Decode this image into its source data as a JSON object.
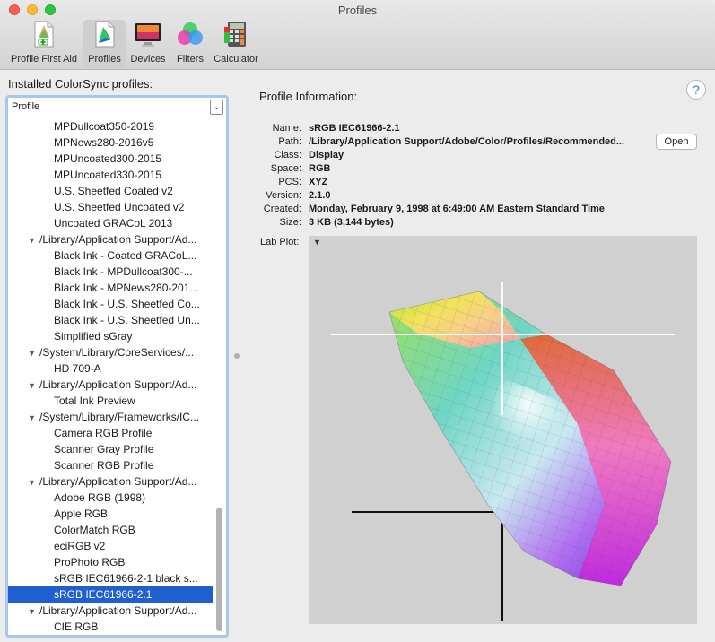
{
  "window": {
    "title": "Profiles"
  },
  "toolbar": [
    {
      "label": "Profile First Aid",
      "icon": "profile-first-aid-icon"
    },
    {
      "label": "Profiles",
      "icon": "profiles-icon",
      "active": true
    },
    {
      "label": "Devices",
      "icon": "devices-icon"
    },
    {
      "label": "Filters",
      "icon": "filters-icon"
    },
    {
      "label": "Calculator",
      "icon": "calculator-icon"
    }
  ],
  "left": {
    "heading": "Installed ColorSync profiles:",
    "column_header": "Profile",
    "rows": [
      {
        "label": "MPDullcoat350-2019",
        "level": 2
      },
      {
        "label": "MPNews280-2016v5",
        "level": 2
      },
      {
        "label": "MPUncoated300-2015",
        "level": 2
      },
      {
        "label": "MPUncoated330-2015",
        "level": 2
      },
      {
        "label": "U.S. Sheetfed Coated v2",
        "level": 2
      },
      {
        "label": "U.S. Sheetfed Uncoated v2",
        "level": 2
      },
      {
        "label": "Uncoated GRACoL 2013",
        "level": 2
      },
      {
        "label": "/Library/Application Support/Ad...",
        "level": 1
      },
      {
        "label": "Black Ink - Coated GRACoL...",
        "level": 2
      },
      {
        "label": "Black Ink - MPDullcoat300-...",
        "level": 2
      },
      {
        "label": "Black Ink - MPNews280-201...",
        "level": 2
      },
      {
        "label": "Black Ink - U.S. Sheetfed Co...",
        "level": 2
      },
      {
        "label": "Black Ink - U.S. Sheetfed Un...",
        "level": 2
      },
      {
        "label": "Simplified sGray",
        "level": 2
      },
      {
        "label": "/System/Library/CoreServices/...",
        "level": 1
      },
      {
        "label": "HD 709-A",
        "level": 2
      },
      {
        "label": "/Library/Application Support/Ad...",
        "level": 1
      },
      {
        "label": "Total Ink Preview",
        "level": 2
      },
      {
        "label": "/System/Library/Frameworks/IC...",
        "level": 1
      },
      {
        "label": "Camera RGB Profile",
        "level": 2
      },
      {
        "label": "Scanner Gray Profile",
        "level": 2
      },
      {
        "label": "Scanner RGB Profile",
        "level": 2
      },
      {
        "label": "/Library/Application Support/Ad...",
        "level": 1
      },
      {
        "label": "Adobe RGB (1998)",
        "level": 2
      },
      {
        "label": "Apple RGB",
        "level": 2
      },
      {
        "label": "ColorMatch RGB",
        "level": 2
      },
      {
        "label": "eciRGB v2",
        "level": 2
      },
      {
        "label": "ProPhoto RGB",
        "level": 2
      },
      {
        "label": "sRGB IEC61966-2-1 black s...",
        "level": 2
      },
      {
        "label": "sRGB IEC61966-2.1",
        "level": 2,
        "selected": true
      },
      {
        "label": "/Library/Application Support/Ad...",
        "level": 1
      },
      {
        "label": "CIE RGB",
        "level": 2
      }
    ]
  },
  "info": {
    "heading": "Profile Information:",
    "help_label": "?",
    "fields": [
      {
        "key": "Name:",
        "value": "sRGB IEC61966-2.1"
      },
      {
        "key": "Path:",
        "value": "/Library/Application Support/Adobe/Color/Profiles/Recommended..."
      },
      {
        "key": "Class:",
        "value": "Display"
      },
      {
        "key": "Space:",
        "value": "RGB"
      },
      {
        "key": "PCS:",
        "value": "XYZ"
      },
      {
        "key": "Version:",
        "value": "2.1.0"
      },
      {
        "key": "Created:",
        "value": "Monday, February 9, 1998 at 6:49:00 AM Eastern Standard Time"
      },
      {
        "key": "Size:",
        "value": "3 KB (3,144 bytes)"
      }
    ],
    "open_label": "Open",
    "lab_plot_label": "Lab Plot:"
  },
  "colors": {
    "selection": "#1f5fd0",
    "focus_ring": "#a8c7ee",
    "plot_background": "#d0d0d0"
  }
}
